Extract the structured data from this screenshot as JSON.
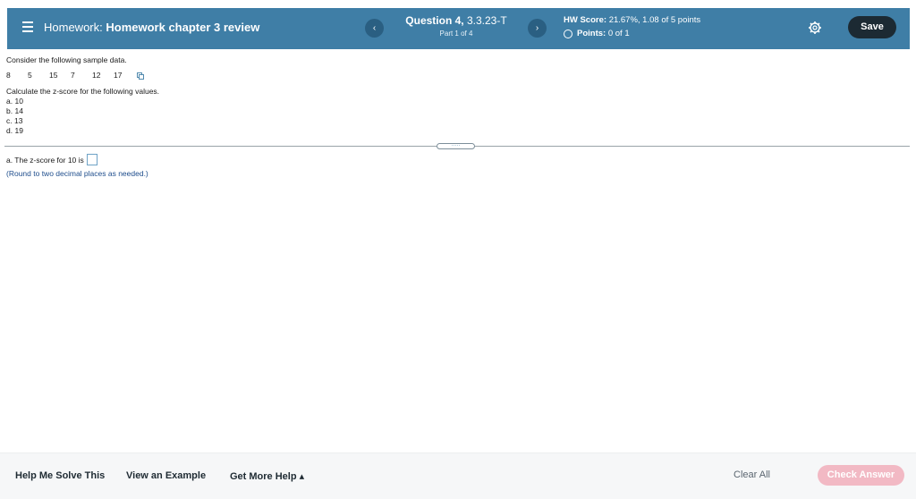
{
  "header": {
    "title_prefix": "Homework:",
    "title_name": "Homework chapter 3 review",
    "prev_label": "‹",
    "next_label": "›",
    "question_label": "Question 4,",
    "question_id": "3.3.23-T",
    "part_label": "Part 1 of 4",
    "hw_score_label": "HW Score:",
    "hw_score_value": "21.67%, 1.08 of 5 points",
    "points_label": "Points:",
    "points_value": "0 of 1",
    "save_label": "Save"
  },
  "question": {
    "intro": "Consider the following sample data.",
    "sample_values": [
      "8",
      "5",
      "15",
      "7",
      "12",
      "17"
    ],
    "instruction": "Calculate the z-score for the following values.",
    "parts": [
      {
        "letter": "a.",
        "value": "10"
      },
      {
        "letter": "b.",
        "value": "14"
      },
      {
        "letter": "c.",
        "value": "13"
      },
      {
        "letter": "d.",
        "value": "19"
      }
    ],
    "splitter_label": "·····"
  },
  "answer": {
    "prompt": "a. The z-score for 10 is",
    "hint": "(Round to two decimal places as needed.)"
  },
  "footer": {
    "help_solve": "Help Me Solve This",
    "view_example": "View an Example",
    "more_help": "Get More Help ▴",
    "clear_all": "Clear All",
    "check_answer": "Check Answer"
  },
  "colors": {
    "header_bg": "#3f7ea6",
    "save_bg": "#1c2a33",
    "check_bg": "#f2b9c4",
    "hint_text": "#1e4d8c"
  }
}
